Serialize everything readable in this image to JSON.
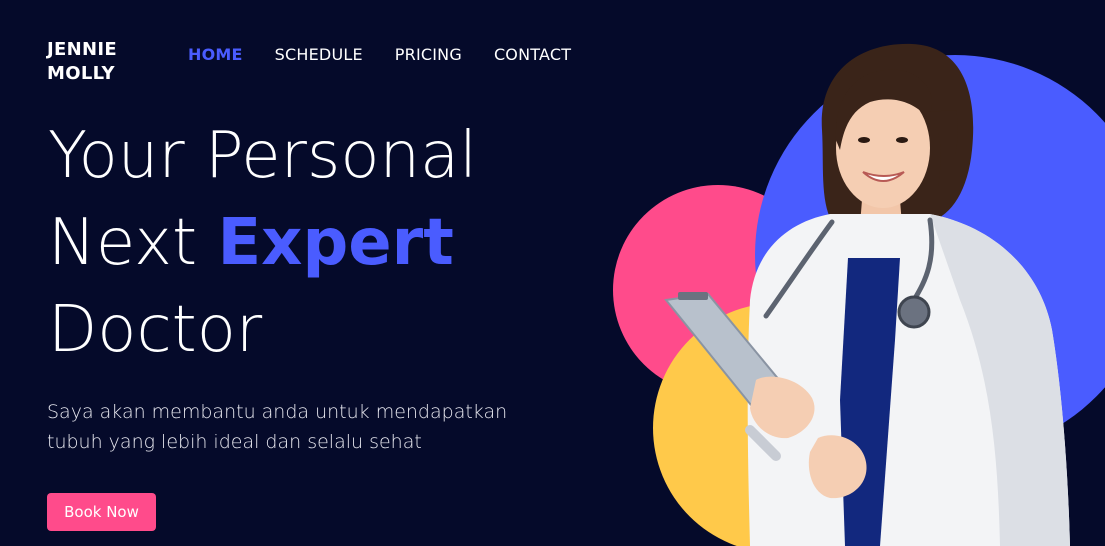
{
  "brand": {
    "name": "JENNIE\nMOLLY"
  },
  "nav": {
    "items": [
      {
        "label": "HOME",
        "active": true
      },
      {
        "label": "SCHEDULE",
        "active": false
      },
      {
        "label": "PRICING",
        "active": false
      },
      {
        "label": "CONTACT",
        "active": false
      }
    ]
  },
  "hero": {
    "line1": "Your Personal",
    "line2_prefix": "Next ",
    "line2_accent": "Expert",
    "line3": "Doctor",
    "subtitle": "Saya akan membantu anda untuk mendapatkan tubuh yang lebih ideal dan selalu sehat",
    "cta_label": "Book Now"
  },
  "colors": {
    "background": "#050a2a",
    "accent_blue": "#4a5cff",
    "accent_pink": "#ff4b8b",
    "accent_yellow": "#ffc94a"
  },
  "illustration": {
    "subject": "doctor-portrait",
    "shapes": [
      "pink-circle",
      "yellow-circle",
      "blue-circle"
    ]
  }
}
